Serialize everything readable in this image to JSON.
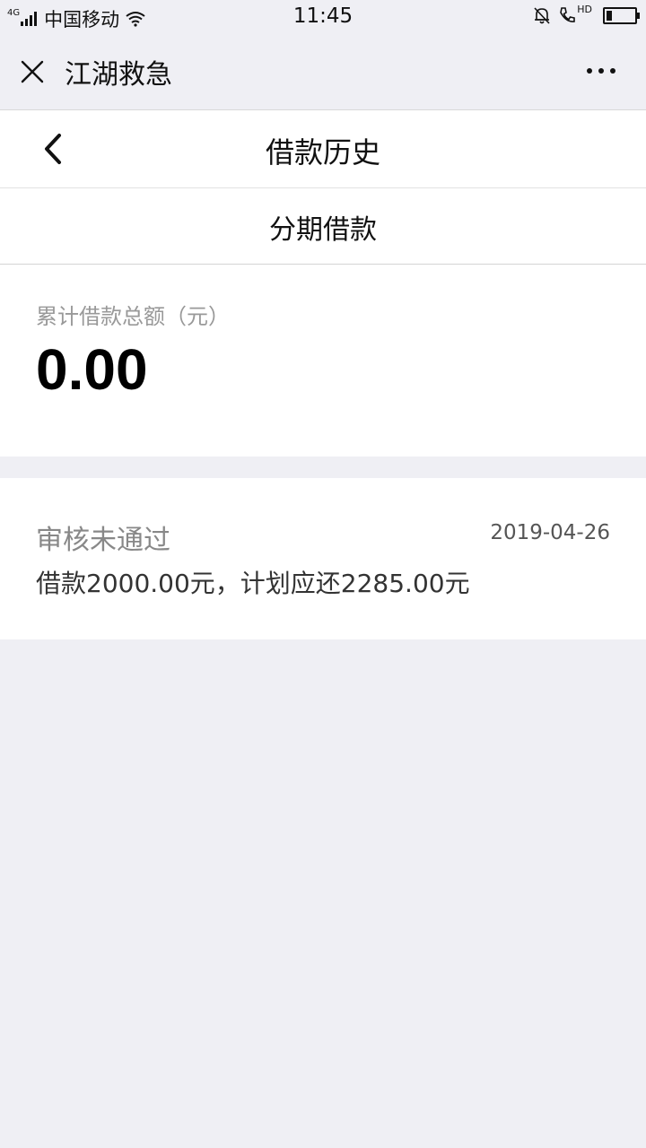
{
  "status_bar": {
    "network_type": "4G",
    "carrier": "中国移动",
    "time": "11:45",
    "hd_label": "HD",
    "icons": [
      "signal-icon",
      "wifi-icon",
      "mute-bell-icon",
      "hd-call-icon",
      "battery-icon"
    ]
  },
  "wechat_bar": {
    "title": "江湖救急",
    "close_icon": "close-icon",
    "more_icon": "more-icon"
  },
  "nav": {
    "title": "借款历史",
    "back_icon": "chevron-left-icon"
  },
  "tab": {
    "label": "分期借款"
  },
  "summary": {
    "label": "累计借款总额（元）",
    "amount": "0.00"
  },
  "records": [
    {
      "status": "审核未通过",
      "date": "2019-04-26",
      "description": "借款2000.00元，计划应还2285.00元"
    }
  ],
  "colors": {
    "background": "#efeff4",
    "card": "#ffffff",
    "muted_text": "#999999"
  }
}
